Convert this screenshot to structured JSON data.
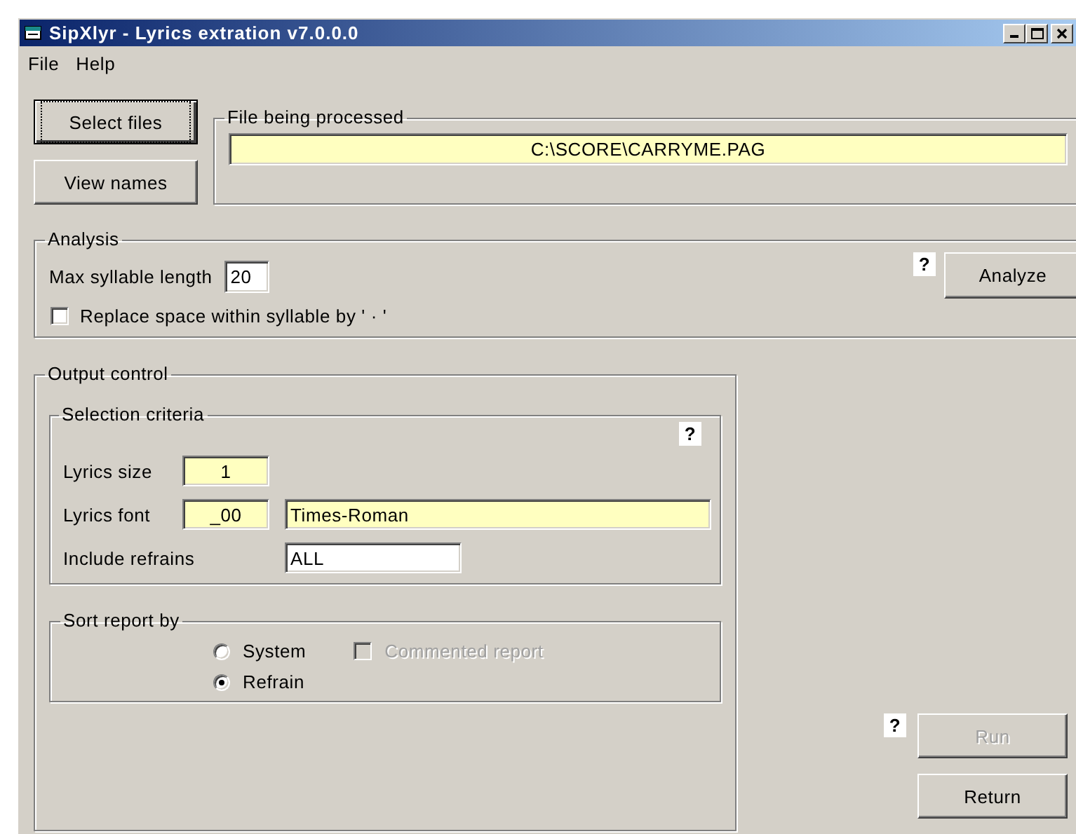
{
  "window": {
    "title": "SipXlyr - Lyrics extration v7.0.0.0"
  },
  "menu": [
    "File",
    "Help"
  ],
  "side_buttons": [
    {
      "label": "Select files",
      "default": true
    },
    {
      "label": "View names",
      "default": false
    }
  ],
  "file_being_processed": {
    "title": "File being processed",
    "value": "C:\\SCORE\\CARRYME.PAG"
  },
  "analysis": {
    "title": "Analysis",
    "max_syllable_length": {
      "label": "Max syllable length",
      "value": "20"
    },
    "replace_space": {
      "label": "Replace space within syllable by ' · '",
      "checked": false
    },
    "help": "?",
    "button": "Analyze"
  },
  "output_control": {
    "title": "Output control",
    "selection_criteria": {
      "title": "Selection criteria",
      "help": "?",
      "rows": [
        {
          "label": "Lyrics size",
          "fields": [
            {
              "kind": "short",
              "value": "1",
              "highlighted": true
            }
          ]
        },
        {
          "label": "Lyrics font",
          "fields": [
            {
              "kind": "short",
              "value": "_00",
              "highlighted": true
            },
            {
              "kind": "wide",
              "value": "Times-Roman",
              "highlighted": true
            }
          ]
        },
        {
          "label": "Include refrains",
          "fields": [
            {
              "kind": "medium",
              "value": "ALL",
              "highlighted": false
            }
          ]
        }
      ]
    },
    "sort_report_by": {
      "title": "Sort report by",
      "options": [
        {
          "label": "System",
          "selected": false
        },
        {
          "label": "Refrain",
          "selected": true
        }
      ],
      "commented_report": {
        "label": "Commented report",
        "checked": false,
        "disabled": true
      }
    }
  },
  "actions": {
    "help": "?",
    "buttons": [
      {
        "label": "Run",
        "disabled": true
      },
      {
        "label": "Return",
        "disabled": false
      }
    ]
  }
}
